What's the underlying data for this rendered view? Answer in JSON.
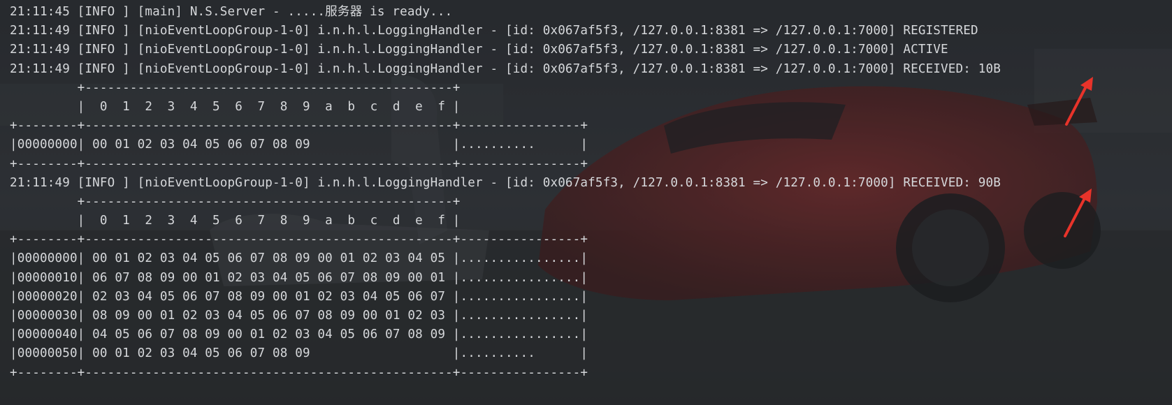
{
  "console": {
    "lines": [
      "21:11:45 [INFO ] [main] N.S.Server - .....服务器 is ready...",
      "21:11:49 [INFO ] [nioEventLoopGroup-1-0] i.n.h.l.LoggingHandler - [id: 0x067af5f3, /127.0.0.1:8381 => /127.0.0.1:7000] REGISTERED",
      "21:11:49 [INFO ] [nioEventLoopGroup-1-0] i.n.h.l.LoggingHandler - [id: 0x067af5f3, /127.0.0.1:8381 => /127.0.0.1:7000] ACTIVE",
      "21:11:49 [INFO ] [nioEventLoopGroup-1-0] i.n.h.l.LoggingHandler - [id: 0x067af5f3, /127.0.0.1:8381 => /127.0.0.1:7000] RECEIVED: 10B",
      "         +-------------------------------------------------+",
      "         |  0  1  2  3  4  5  6  7  8  9  a  b  c  d  e  f |",
      "+--------+-------------------------------------------------+----------------+",
      "|00000000| 00 01 02 03 04 05 06 07 08 09                   |..........      |",
      "+--------+-------------------------------------------------+----------------+",
      "21:11:49 [INFO ] [nioEventLoopGroup-1-0] i.n.h.l.LoggingHandler - [id: 0x067af5f3, /127.0.0.1:8381 => /127.0.0.1:7000] RECEIVED: 90B",
      "         +-------------------------------------------------+",
      "         |  0  1  2  3  4  5  6  7  8  9  a  b  c  d  e  f |",
      "+--------+-------------------------------------------------+----------------+",
      "|00000000| 00 01 02 03 04 05 06 07 08 09 00 01 02 03 04 05 |................|",
      "|00000010| 06 07 08 09 00 01 02 03 04 05 06 07 08 09 00 01 |................|",
      "|00000020| 02 03 04 05 06 07 08 09 00 01 02 03 04 05 06 07 |................|",
      "|00000030| 08 09 00 01 02 03 04 05 06 07 08 09 00 01 02 03 |................|",
      "|00000040| 04 05 06 07 08 09 00 01 02 03 04 05 06 07 08 09 |................|",
      "|00000050| 00 01 02 03 04 05 06 07 08 09                   |..........      |",
      "+--------+-------------------------------------------------+----------------+"
    ]
  },
  "colors": {
    "background": "#2a2d31",
    "text": "#d6d8db",
    "annotation": "#e8332a",
    "car": "#8e2a2a"
  },
  "icons": [
    "annotation-arrow-icon"
  ]
}
